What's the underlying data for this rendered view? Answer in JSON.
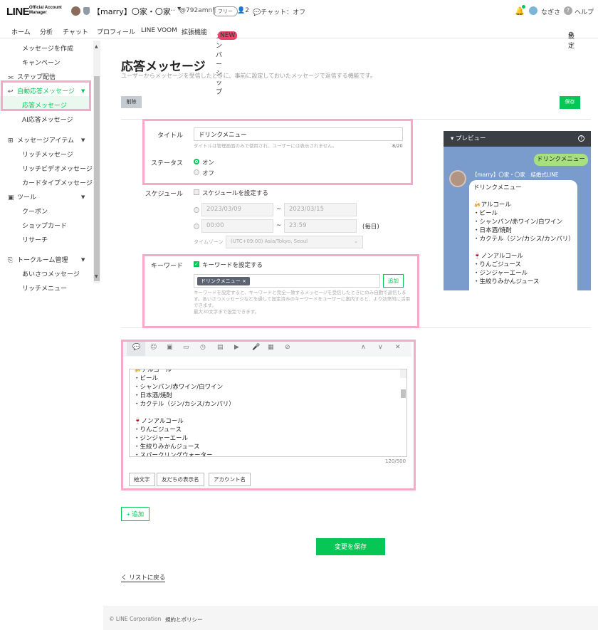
{
  "header": {
    "logo_main": "LINE",
    "logo_sub_1": "Official Account",
    "logo_sub_2": "Manager",
    "account_name": "【marry】〇家・〇家",
    "account_caret": "… ▾",
    "account_id": "@792amnlj",
    "plan": "フリー",
    "friends_count": "2",
    "chat_status": "チャット：オフ",
    "user_name": "なぎさ",
    "help": "ヘルプ"
  },
  "nav": {
    "tabs": [
      "ホーム",
      "分析",
      "チャット",
      "プロフィール",
      "LINE VOOM",
      "拡張機能",
      "メンバーシップ"
    ],
    "new_badge": "NEW",
    "settings": "設定"
  },
  "sidebar": {
    "create_message": "メッセージを作成",
    "campaign": "キャンペーン",
    "step": "ステップ配信",
    "auto_reply": "自動応答メッセージ",
    "reply_message": "応答メッセージ",
    "ai_reply": "AI応答メッセージ",
    "message_items": "メッセージアイテム",
    "rich_message": "リッチメッセージ",
    "rich_video": "リッチビデオメッセージ",
    "card_type": "カードタイプメッセージ",
    "tools": "ツール",
    "coupon": "クーポン",
    "shop_card": "ショップカード",
    "research": "リサーチ",
    "talkroom": "トークルーム管理",
    "greeting": "あいさつメッセージ",
    "rich_menu": "リッチメニュー"
  },
  "page": {
    "title": "応答メッセージ",
    "subtitle": "ユーザーからメッセージを受信したときに、事前に設定しておいたメッセージで返信する機能です。",
    "delete_button": "削除",
    "save_button": "保存"
  },
  "form": {
    "title_label": "タイトル",
    "title_value": "ドリンクメニュー",
    "title_hint": "タイトルは管理画面のみで使用され、ユーザーには表示されません。",
    "title_count": "8/20",
    "status_label": "ステータス",
    "status_on": "オン",
    "status_off": "オフ",
    "schedule_label": "スケジュール",
    "schedule_checkbox": "スケジュールを設定する",
    "date_start": "2023/03/09",
    "date_end": "2023/03/15",
    "time_start": "00:00",
    "time_end": "23:59",
    "tilde": "~",
    "daily": "(毎日)",
    "timezone_label": "タイムゾーン",
    "timezone_value": "(UTC+09:00) Asia/Tokyo, Seoul",
    "keyword_label": "キーワード",
    "keyword_checkbox": "キーワードを設定する",
    "keyword_tag": "ドリンクメニュー",
    "keyword_add": "追加",
    "keyword_help_1": "キーワードを設定すると、キーワードと完全一致するメッセージを受信したときにのみ自動で返信しま",
    "keyword_help_2": "す。あいさつメッセージなどを通して設定済みのキーワードをユーザーに案内すると、より効率的に活用",
    "keyword_help_3": "できます。",
    "keyword_help_4": "最大30文字まで設定できます。"
  },
  "preview": {
    "header": "プレビュー",
    "user_bubble": "ドリンクメニュー",
    "sender": "【marry】〇家・〇家　結婚式LINE",
    "lines": [
      "ドリンクメニュー",
      "",
      "🍻アルコール",
      "・ビール",
      "・シャンパン/赤ワイン/白ワイン",
      "・日本酒/焼酎",
      "・カクテル（ジン/カシス/カンパリ）",
      "",
      "🍷ノンアルコール",
      "・りんごジュース",
      "・ジンジャーエール",
      "・生絞りみかんジュース"
    ]
  },
  "editor": {
    "lines": [
      "🍻アルコール",
      "・ビール",
      "・シャンパン/赤ワイン/白ワイン",
      "・日本酒/焼酎",
      "・カクテル（ジン/カシス/カンパリ）",
      "",
      "🍷ノンアルコール",
      "・りんごジュース",
      "・ジンジャーエール",
      "・生絞りみかんジュース",
      "・スパークリングウォーター"
    ],
    "count": "120/500",
    "emoji_chip": "絵文字",
    "friend_name_chip": "友だちの表示名",
    "account_name_chip": "アカウント名"
  },
  "actions": {
    "add": "+ 追加",
    "save_changes": "変更を保存",
    "back": "く リストに戻る"
  },
  "footer": {
    "copyright": "© LINE Corporation",
    "terms": "規約とポリシー"
  },
  "colors": {
    "brand": "#06c755",
    "highlight": "#f6a9c8"
  }
}
